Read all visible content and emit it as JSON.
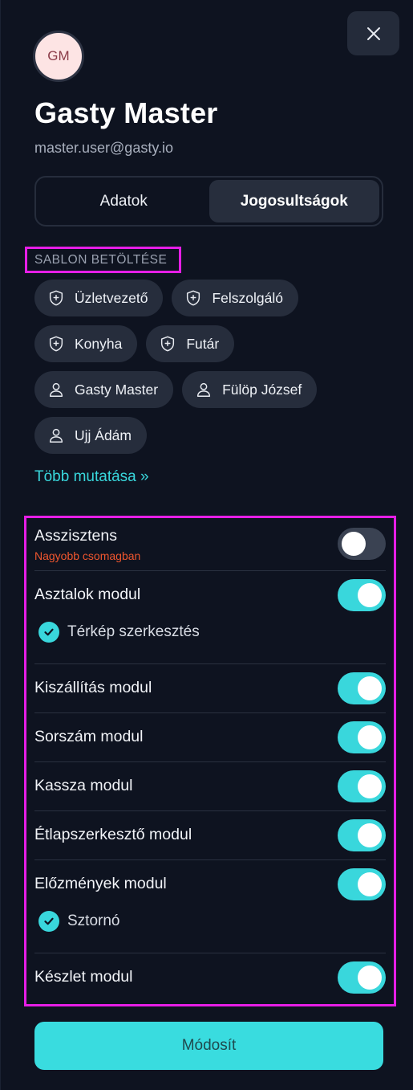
{
  "user": {
    "initials": "GM",
    "name": "Gasty Master",
    "email": "master.user@gasty.io"
  },
  "tabs": [
    {
      "label": "Adatok",
      "active": false
    },
    {
      "label": "Jogosultságok",
      "active": true
    }
  ],
  "template_section": {
    "label": "SABLON BETÖLTÉSE",
    "chips": [
      {
        "label": "Üzletvezető",
        "icon": "shield-plus-icon"
      },
      {
        "label": "Felszolgáló",
        "icon": "shield-plus-icon"
      },
      {
        "label": "Konyha",
        "icon": "shield-plus-icon"
      },
      {
        "label": "Futár",
        "icon": "shield-plus-icon"
      },
      {
        "label": "Gasty Master",
        "icon": "user-icon"
      },
      {
        "label": "Fülöp József",
        "icon": "user-icon"
      },
      {
        "label": "Ujj Ádám",
        "icon": "user-icon"
      }
    ],
    "more_link": "Több mutatása »"
  },
  "modules": [
    {
      "title": "Asszisztens",
      "subtitle": "Nagyobb csomagban",
      "enabled": false
    },
    {
      "title": "Asztalok modul",
      "enabled": true,
      "sub_items": [
        "Térkép szerkesztés"
      ]
    },
    {
      "title": "Kiszállítás modul",
      "enabled": true
    },
    {
      "title": "Sorszám modul",
      "enabled": true
    },
    {
      "title": "Kassza modul",
      "enabled": true
    },
    {
      "title": "Étlapszerkesztő modul",
      "enabled": true
    },
    {
      "title": "Előzmények modul",
      "enabled": true,
      "sub_items": [
        "Sztornó"
      ]
    },
    {
      "title": "Készlet modul",
      "enabled": true
    }
  ],
  "submit_label": "Módosít",
  "colors": {
    "accent": "#39d7dc",
    "warning": "#f0562e",
    "highlight_border": "#e61ee6",
    "background": "#0e1320"
  }
}
